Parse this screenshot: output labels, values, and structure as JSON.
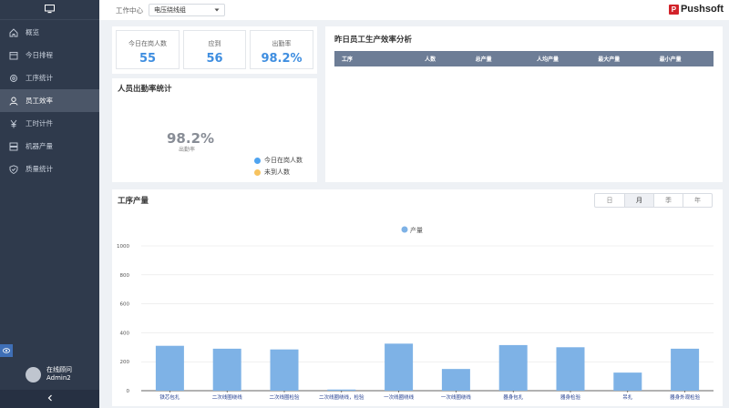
{
  "sidebar": {
    "items": [
      {
        "label": "概览",
        "icon": "home-icon"
      },
      {
        "label": "今日排程",
        "icon": "calendar-icon"
      },
      {
        "label": "工序统计",
        "icon": "gear-icon"
      },
      {
        "label": "员工效率",
        "icon": "user-icon"
      },
      {
        "label": "工时计件",
        "icon": "yen-icon"
      },
      {
        "label": "机器产量",
        "icon": "server-icon"
      },
      {
        "label": "质量统计",
        "icon": "shield-icon"
      }
    ],
    "active_index": 3,
    "user": {
      "status": "在线顾问",
      "name": "Admin2"
    }
  },
  "topbar": {
    "label": "工作中心",
    "select_value": "电压绕线组",
    "brand": "Pushsoft"
  },
  "stats": [
    {
      "label": "今日在岗人数",
      "value": "55"
    },
    {
      "label": "应到",
      "value": "56"
    },
    {
      "label": "出勤率",
      "value": "98.2%"
    }
  ],
  "attendance": {
    "title": "人员出勤率统计",
    "rate": "98.2%",
    "rate_label": "出勤率",
    "legend": [
      {
        "name": "今日在岗人数",
        "color": "#4fa4f0"
      },
      {
        "name": "未到人数",
        "color": "#f7c35f"
      }
    ]
  },
  "efficiency": {
    "title": "昨日员工生产效率分析",
    "columns": [
      "工序",
      "人数",
      "总产量",
      "人均产量",
      "最大产量",
      "最小产量"
    ]
  },
  "output": {
    "title": "工序产量",
    "periods": [
      "日",
      "月",
      "季",
      "年"
    ],
    "active_period": 1
  },
  "chart_data": {
    "type": "bar",
    "title": "",
    "xlabel": "",
    "ylabel": "",
    "ylim": [
      0,
      1000
    ],
    "yticks": [
      0,
      200,
      400,
      600,
      800,
      1000
    ],
    "categories": [
      "铁芯包扎",
      "二次线圈绕线",
      "二次线圈检验",
      "二次线圈绕线，检验",
      "一次线圈绕线",
      "一次线圈绕线",
      "器身包扎",
      "器身检验",
      "吊扎",
      "器身外观检验"
    ],
    "series": [
      {
        "name": "产量",
        "color": "#7eb2e6",
        "values": [
          310,
          290,
          285,
          8,
          325,
          150,
          315,
          300,
          125,
          290
        ]
      }
    ],
    "legend_position": "top-center",
    "grid": true
  }
}
